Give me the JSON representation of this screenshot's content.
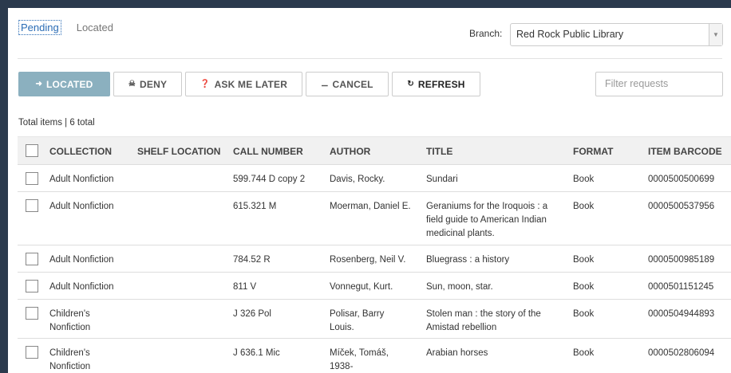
{
  "tabs": [
    {
      "label": "Pending",
      "active": true
    },
    {
      "label": "Located",
      "active": false
    }
  ],
  "branch": {
    "label": "Branch:",
    "selected": "Red Rock Public Library"
  },
  "toolbar": {
    "located": {
      "label": "LOCATED",
      "icon": "sign-in-icon"
    },
    "deny": {
      "label": "DENY",
      "icon": "thumbs-down-icon"
    },
    "ask_later": {
      "label": "ASK ME LATER",
      "icon": "question-circle-icon"
    },
    "cancel": {
      "label": "CANCEL",
      "icon": "minus-circle-icon"
    },
    "refresh": {
      "label": "REFRESH",
      "icon": "refresh-icon"
    }
  },
  "filter": {
    "placeholder": "Filter requests"
  },
  "total": "Total items | 6 total",
  "columns": [
    "COLLECTION",
    "SHELF LOCATION",
    "CALL NUMBER",
    "AUTHOR",
    "TITLE",
    "FORMAT",
    "ITEM BARCODE"
  ],
  "rows": [
    {
      "collection": "Adult Nonfiction",
      "shelf": "",
      "call": "599.744 D copy 2",
      "author": "Davis, Rocky.",
      "title": "Sundari",
      "format": "Book",
      "barcode": "0000500500699"
    },
    {
      "collection": "Adult Nonfiction",
      "shelf": "",
      "call": "615.321 M",
      "author": "Moerman, Daniel E.",
      "title": "Geraniums for the Iroquois : a field guide to American Indian medicinal plants.",
      "format": "Book",
      "barcode": "0000500537956"
    },
    {
      "collection": "Adult Nonfiction",
      "shelf": "",
      "call": "784.52 R",
      "author": "Rosenberg, Neil V.",
      "title": "Bluegrass : a history",
      "format": "Book",
      "barcode": "0000500985189"
    },
    {
      "collection": "Adult Nonfiction",
      "shelf": "",
      "call": "811 V",
      "author": "Vonnegut, Kurt.",
      "title": "Sun, moon, star.",
      "format": "Book",
      "barcode": "0000501151245"
    },
    {
      "collection": "Children's Nonfiction",
      "shelf": "",
      "call": "J 326 Pol",
      "author": "Polisar, Barry Louis.",
      "title": "Stolen man : the story of the Amistad rebellion",
      "format": "Book",
      "barcode": "0000504944893"
    },
    {
      "collection": "Children's Nonfiction",
      "shelf": "",
      "call": "J 636.1 Mic",
      "author": "Míček, Tomáš, 1938-",
      "title": "Arabian horses",
      "format": "Book",
      "barcode": "0000502806094"
    }
  ]
}
